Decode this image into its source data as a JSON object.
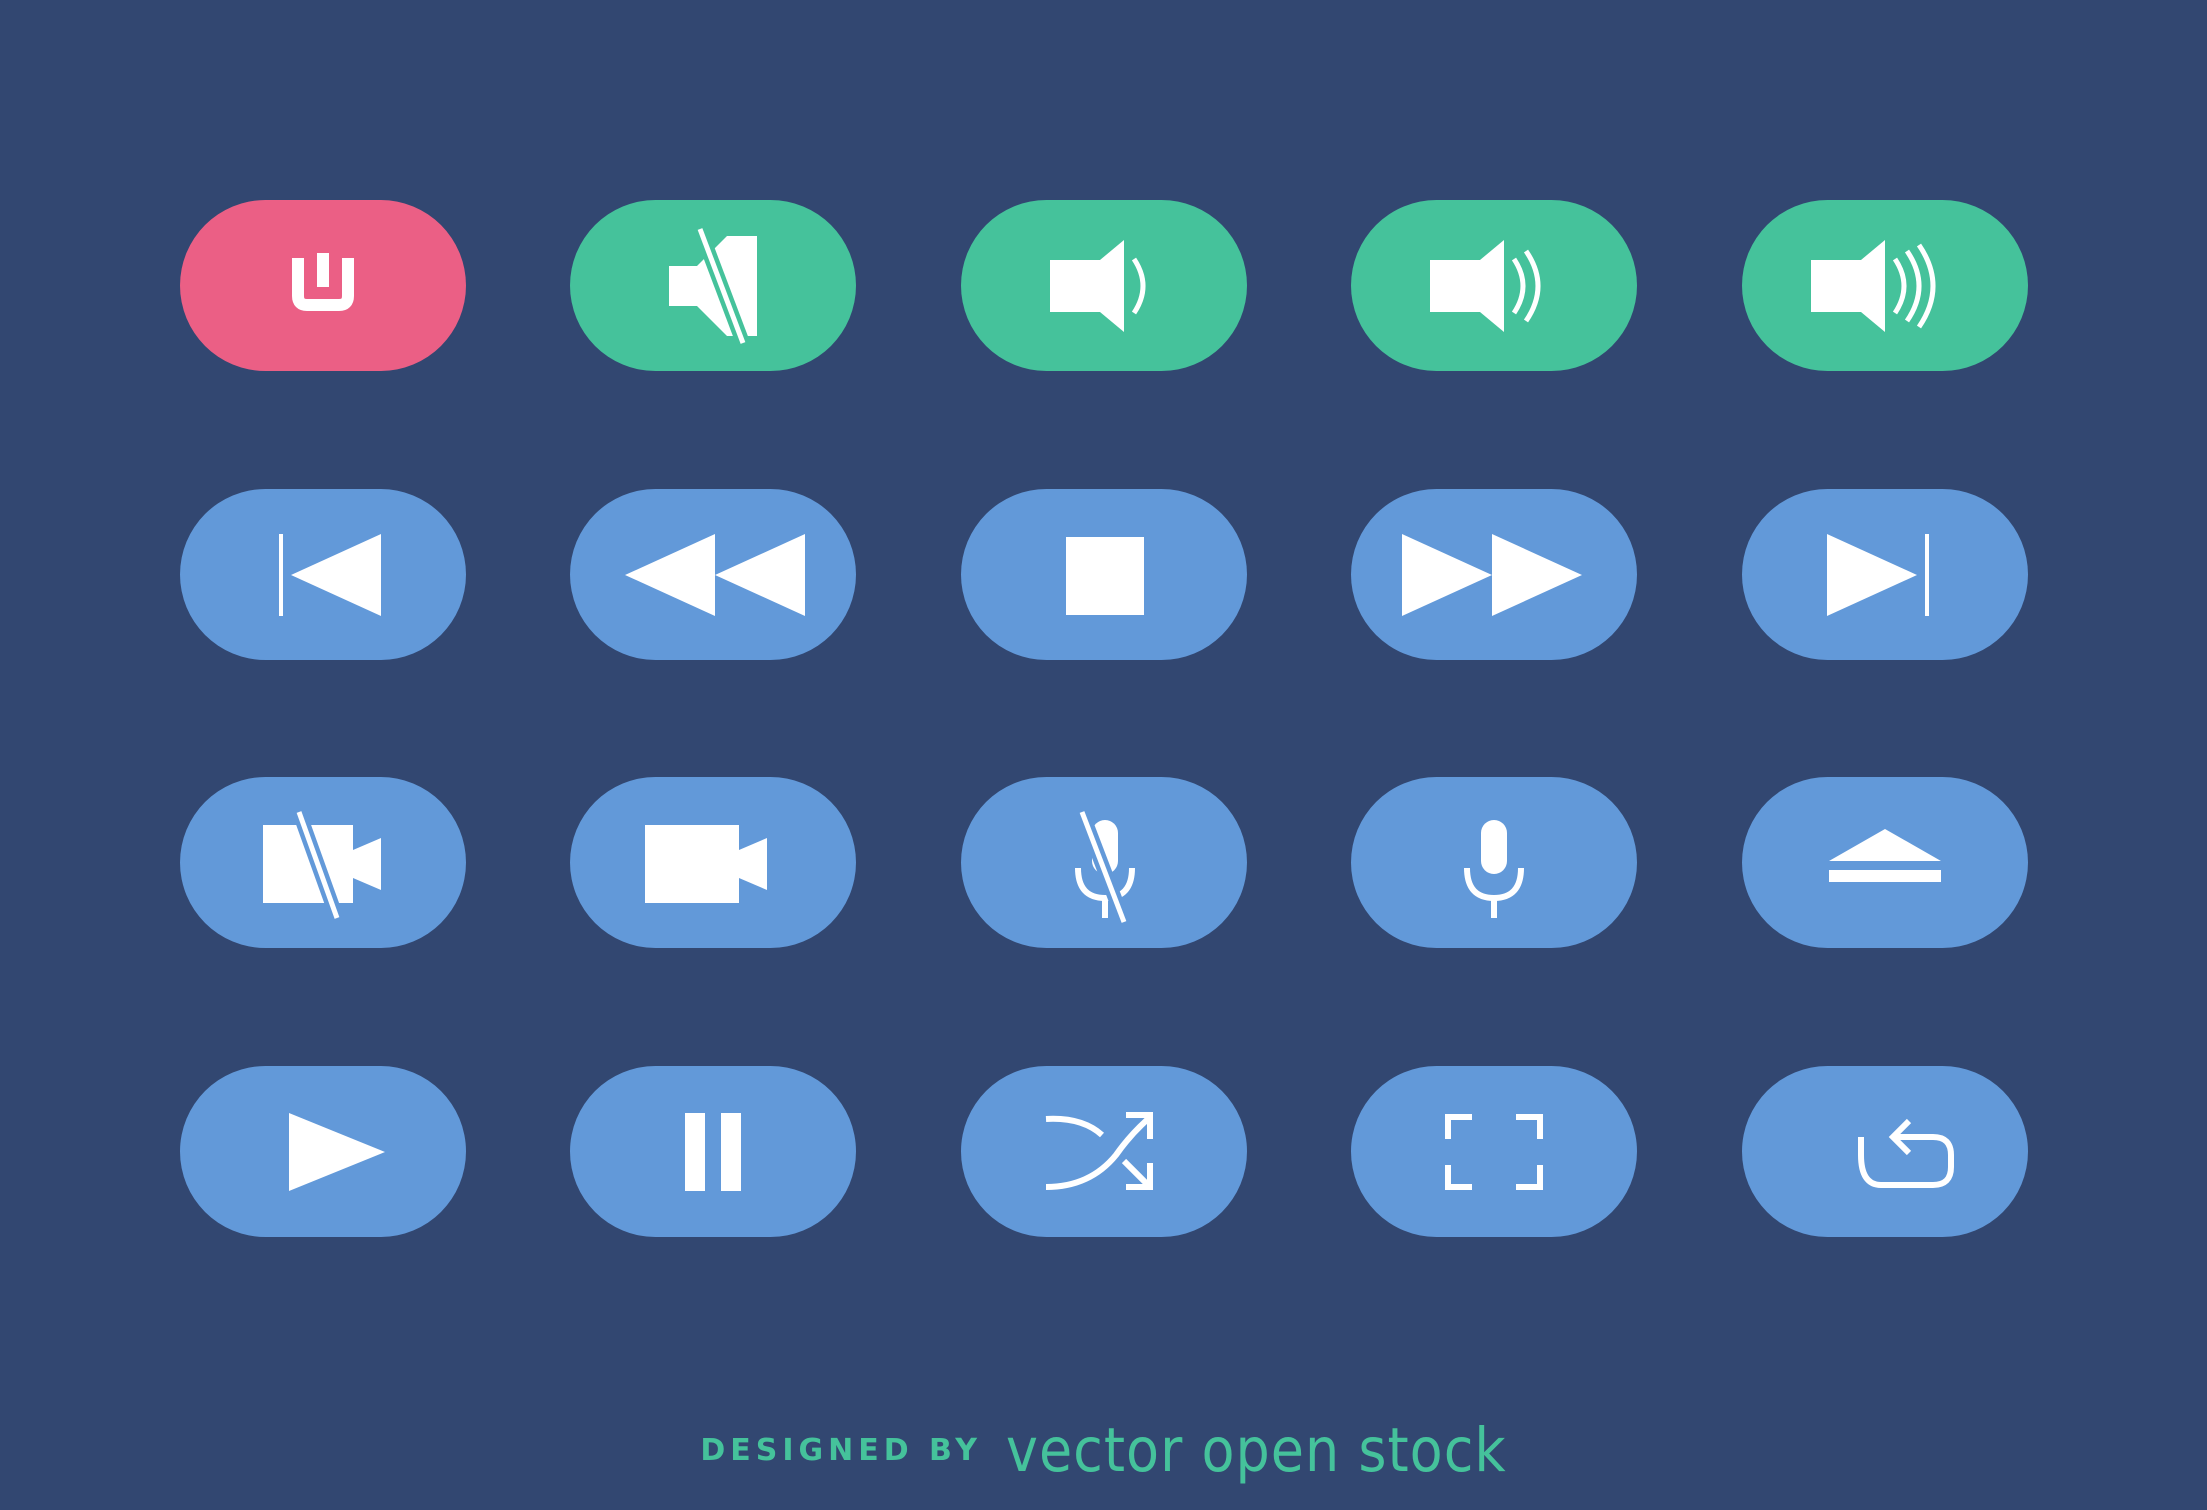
{
  "colors": {
    "background": "#324771",
    "power": "#EB5F85",
    "volume": "#45C29B",
    "media": "#6299D9",
    "icon": "#FFFFFF",
    "footer_text": "#45C29B"
  },
  "buttons": [
    [
      {
        "name": "power-button",
        "icon": "power-icon",
        "color": "power"
      },
      {
        "name": "volume-mute-button",
        "icon": "volume-mute-icon",
        "color": "volume"
      },
      {
        "name": "volume-low-button",
        "icon": "volume-low-icon",
        "color": "volume"
      },
      {
        "name": "volume-medium-button",
        "icon": "volume-medium-icon",
        "color": "volume"
      },
      {
        "name": "volume-high-button",
        "icon": "volume-high-icon",
        "color": "volume"
      }
    ],
    [
      {
        "name": "skip-previous-button",
        "icon": "skip-previous-icon",
        "color": "media"
      },
      {
        "name": "rewind-button",
        "icon": "rewind-icon",
        "color": "media"
      },
      {
        "name": "stop-button",
        "icon": "stop-icon",
        "color": "media"
      },
      {
        "name": "fast-forward-button",
        "icon": "fast-forward-icon",
        "color": "media"
      },
      {
        "name": "skip-next-button",
        "icon": "skip-next-icon",
        "color": "media"
      }
    ],
    [
      {
        "name": "video-off-button",
        "icon": "video-off-icon",
        "color": "media"
      },
      {
        "name": "video-button",
        "icon": "video-camera-icon",
        "color": "media"
      },
      {
        "name": "mic-off-button",
        "icon": "mic-off-icon",
        "color": "media"
      },
      {
        "name": "mic-button",
        "icon": "microphone-icon",
        "color": "media"
      },
      {
        "name": "eject-button",
        "icon": "eject-icon",
        "color": "media"
      }
    ],
    [
      {
        "name": "play-button",
        "icon": "play-icon",
        "color": "media"
      },
      {
        "name": "pause-button",
        "icon": "pause-icon",
        "color": "media"
      },
      {
        "name": "shuffle-button",
        "icon": "shuffle-icon",
        "color": "media"
      },
      {
        "name": "fullscreen-button",
        "icon": "fullscreen-icon",
        "color": "media"
      },
      {
        "name": "repeat-button",
        "icon": "repeat-icon",
        "color": "media"
      }
    ]
  ],
  "footer": {
    "designed_by": "DESIGNED BY",
    "brand": "vector open stock"
  }
}
